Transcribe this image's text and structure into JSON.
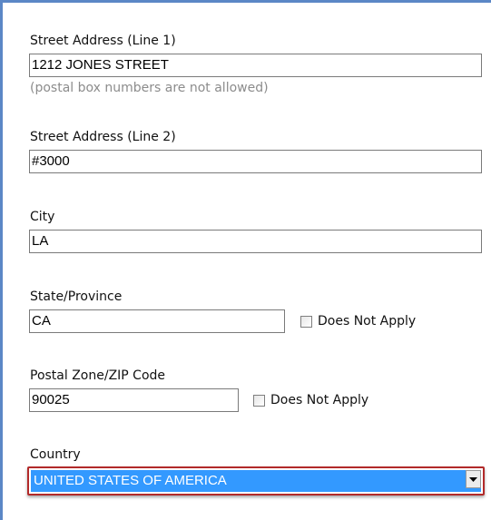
{
  "street1": {
    "label": "Street Address (Line 1)",
    "value": "1212 JONES STREET",
    "hint": "(postal box numbers are not allowed)"
  },
  "street2": {
    "label": "Street Address (Line 2)",
    "value": "#3000"
  },
  "city": {
    "label": "City",
    "value": "LA"
  },
  "state": {
    "label": "State/Province",
    "value": "CA",
    "not_apply_label": "Does Not Apply"
  },
  "postal": {
    "label": "Postal Zone/ZIP Code",
    "value": "90025",
    "not_apply_label": "Does Not Apply"
  },
  "country": {
    "label": "Country",
    "selected": "UNITED STATES OF AMERICA"
  },
  "colors": {
    "frame_border": "#5b87c6",
    "select_highlight": "#3399ff",
    "focus_outline": "#b22a2a"
  }
}
